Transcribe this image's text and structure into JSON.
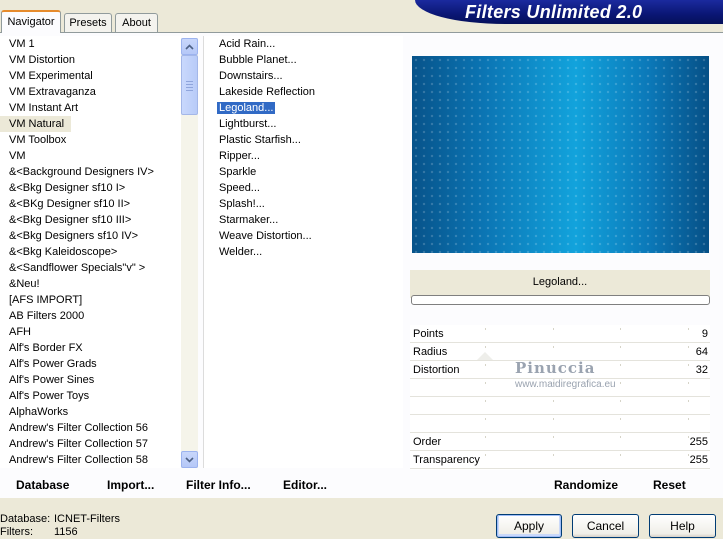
{
  "tabs": [
    {
      "label": "Navigator",
      "active": true
    },
    {
      "label": "Presets",
      "active": false
    },
    {
      "label": "About",
      "active": false
    }
  ],
  "app_title": "Filters Unlimited 2.0",
  "categories": [
    "VM 1",
    "VM Distortion",
    "VM Experimental",
    "VM Extravaganza",
    "VM Instant Art",
    "VM Natural",
    "VM Toolbox",
    "VM",
    "&<Background Designers IV>",
    "&<Bkg Designer sf10 I>",
    "&<BKg Designer sf10 II>",
    "&<Bkg Designer sf10 III>",
    "&<Bkg Designers sf10 IV>",
    "&<Bkg Kaleidoscope>",
    "&<Sandflower Specials\"v\" >",
    "&Neu!",
    "[AFS IMPORT]",
    "AB Filters 2000",
    "AFH",
    "Alf's Border FX",
    "Alf's Power Grads",
    "Alf's Power Sines",
    "Alf's Power Toys",
    "AlphaWorks",
    "Andrew's Filter Collection 56",
    "Andrew's Filter Collection 57",
    "Andrew's Filter Collection 58"
  ],
  "selected_category": "VM Natural",
  "filters": [
    "Acid Rain...",
    "Bubble Planet...",
    "Downstairs...",
    "Lakeside Reflection",
    "Legoland...",
    "Lightburst...",
    "Plastic Starfish...",
    "Ripper...",
    "Sparkle",
    "Speed...",
    "Splash!...",
    "Starmaker...",
    "Weave Distortion...",
    "Welder..."
  ],
  "selected_filter": "Legoland...",
  "preview_filter_name": "Legoland...",
  "parameters": [
    {
      "name": "Points",
      "value": "9"
    },
    {
      "name": "Radius",
      "value": "64"
    },
    {
      "name": "Distortion",
      "value": "32"
    },
    {
      "name": "",
      "value": ""
    },
    {
      "name": "",
      "value": ""
    },
    {
      "name": "",
      "value": ""
    },
    {
      "name": "Order",
      "value": "255"
    },
    {
      "name": "Transparency",
      "value": "255"
    }
  ],
  "watermark": {
    "name": "Pinuccia",
    "url": "www.maidiregrafica.eu"
  },
  "commands": {
    "database": "Database",
    "import": "Import...",
    "filter_info": "Filter Info...",
    "editor": "Editor...",
    "randomize": "Randomize",
    "reset": "Reset"
  },
  "footer": {
    "database_label": "Database:",
    "database_value": "ICNET-Filters",
    "filters_label": "Filters:",
    "filters_value": "1156"
  },
  "buttons": {
    "apply": "Apply",
    "cancel": "Cancel",
    "help": "Help"
  },
  "colors": {
    "selection": "#316ac5",
    "accent_tab": "#e68b2c",
    "title_banner": "#0a1674"
  }
}
